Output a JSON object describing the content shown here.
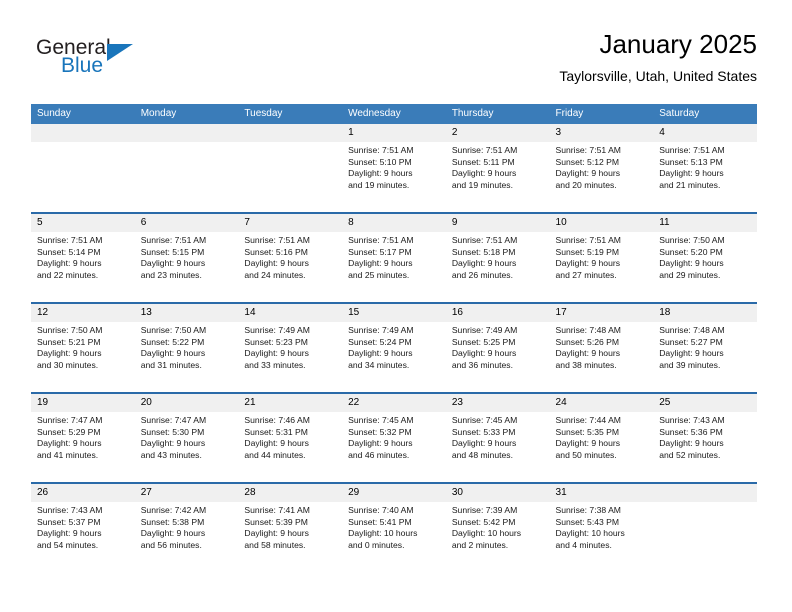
{
  "logo": {
    "text_primary": "General",
    "text_secondary": "Blue",
    "accent_color": "#1975bb"
  },
  "header": {
    "title": "January 2025",
    "subtitle": "Taylorsville, Utah, United States"
  },
  "theme": {
    "header_blue": "#3a7cb9",
    "row_divider_blue": "#2a6aa8",
    "day_band_gray": "#f0f0f0"
  },
  "weekday_headers": [
    "Sunday",
    "Monday",
    "Tuesday",
    "Wednesday",
    "Thursday",
    "Friday",
    "Saturday"
  ],
  "weeks": [
    [
      {
        "day": "",
        "lines": []
      },
      {
        "day": "",
        "lines": []
      },
      {
        "day": "",
        "lines": []
      },
      {
        "day": "1",
        "lines": [
          "Sunrise: 7:51 AM",
          "Sunset: 5:10 PM",
          "Daylight: 9 hours",
          "and 19 minutes."
        ]
      },
      {
        "day": "2",
        "lines": [
          "Sunrise: 7:51 AM",
          "Sunset: 5:11 PM",
          "Daylight: 9 hours",
          "and 19 minutes."
        ]
      },
      {
        "day": "3",
        "lines": [
          "Sunrise: 7:51 AM",
          "Sunset: 5:12 PM",
          "Daylight: 9 hours",
          "and 20 minutes."
        ]
      },
      {
        "day": "4",
        "lines": [
          "Sunrise: 7:51 AM",
          "Sunset: 5:13 PM",
          "Daylight: 9 hours",
          "and 21 minutes."
        ]
      }
    ],
    [
      {
        "day": "5",
        "lines": [
          "Sunrise: 7:51 AM",
          "Sunset: 5:14 PM",
          "Daylight: 9 hours",
          "and 22 minutes."
        ]
      },
      {
        "day": "6",
        "lines": [
          "Sunrise: 7:51 AM",
          "Sunset: 5:15 PM",
          "Daylight: 9 hours",
          "and 23 minutes."
        ]
      },
      {
        "day": "7",
        "lines": [
          "Sunrise: 7:51 AM",
          "Sunset: 5:16 PM",
          "Daylight: 9 hours",
          "and 24 minutes."
        ]
      },
      {
        "day": "8",
        "lines": [
          "Sunrise: 7:51 AM",
          "Sunset: 5:17 PM",
          "Daylight: 9 hours",
          "and 25 minutes."
        ]
      },
      {
        "day": "9",
        "lines": [
          "Sunrise: 7:51 AM",
          "Sunset: 5:18 PM",
          "Daylight: 9 hours",
          "and 26 minutes."
        ]
      },
      {
        "day": "10",
        "lines": [
          "Sunrise: 7:51 AM",
          "Sunset: 5:19 PM",
          "Daylight: 9 hours",
          "and 27 minutes."
        ]
      },
      {
        "day": "11",
        "lines": [
          "Sunrise: 7:50 AM",
          "Sunset: 5:20 PM",
          "Daylight: 9 hours",
          "and 29 minutes."
        ]
      }
    ],
    [
      {
        "day": "12",
        "lines": [
          "Sunrise: 7:50 AM",
          "Sunset: 5:21 PM",
          "Daylight: 9 hours",
          "and 30 minutes."
        ]
      },
      {
        "day": "13",
        "lines": [
          "Sunrise: 7:50 AM",
          "Sunset: 5:22 PM",
          "Daylight: 9 hours",
          "and 31 minutes."
        ]
      },
      {
        "day": "14",
        "lines": [
          "Sunrise: 7:49 AM",
          "Sunset: 5:23 PM",
          "Daylight: 9 hours",
          "and 33 minutes."
        ]
      },
      {
        "day": "15",
        "lines": [
          "Sunrise: 7:49 AM",
          "Sunset: 5:24 PM",
          "Daylight: 9 hours",
          "and 34 minutes."
        ]
      },
      {
        "day": "16",
        "lines": [
          "Sunrise: 7:49 AM",
          "Sunset: 5:25 PM",
          "Daylight: 9 hours",
          "and 36 minutes."
        ]
      },
      {
        "day": "17",
        "lines": [
          "Sunrise: 7:48 AM",
          "Sunset: 5:26 PM",
          "Daylight: 9 hours",
          "and 38 minutes."
        ]
      },
      {
        "day": "18",
        "lines": [
          "Sunrise: 7:48 AM",
          "Sunset: 5:27 PM",
          "Daylight: 9 hours",
          "and 39 minutes."
        ]
      }
    ],
    [
      {
        "day": "19",
        "lines": [
          "Sunrise: 7:47 AM",
          "Sunset: 5:29 PM",
          "Daylight: 9 hours",
          "and 41 minutes."
        ]
      },
      {
        "day": "20",
        "lines": [
          "Sunrise: 7:47 AM",
          "Sunset: 5:30 PM",
          "Daylight: 9 hours",
          "and 43 minutes."
        ]
      },
      {
        "day": "21",
        "lines": [
          "Sunrise: 7:46 AM",
          "Sunset: 5:31 PM",
          "Daylight: 9 hours",
          "and 44 minutes."
        ]
      },
      {
        "day": "22",
        "lines": [
          "Sunrise: 7:45 AM",
          "Sunset: 5:32 PM",
          "Daylight: 9 hours",
          "and 46 minutes."
        ]
      },
      {
        "day": "23",
        "lines": [
          "Sunrise: 7:45 AM",
          "Sunset: 5:33 PM",
          "Daylight: 9 hours",
          "and 48 minutes."
        ]
      },
      {
        "day": "24",
        "lines": [
          "Sunrise: 7:44 AM",
          "Sunset: 5:35 PM",
          "Daylight: 9 hours",
          "and 50 minutes."
        ]
      },
      {
        "day": "25",
        "lines": [
          "Sunrise: 7:43 AM",
          "Sunset: 5:36 PM",
          "Daylight: 9 hours",
          "and 52 minutes."
        ]
      }
    ],
    [
      {
        "day": "26",
        "lines": [
          "Sunrise: 7:43 AM",
          "Sunset: 5:37 PM",
          "Daylight: 9 hours",
          "and 54 minutes."
        ]
      },
      {
        "day": "27",
        "lines": [
          "Sunrise: 7:42 AM",
          "Sunset: 5:38 PM",
          "Daylight: 9 hours",
          "and 56 minutes."
        ]
      },
      {
        "day": "28",
        "lines": [
          "Sunrise: 7:41 AM",
          "Sunset: 5:39 PM",
          "Daylight: 9 hours",
          "and 58 minutes."
        ]
      },
      {
        "day": "29",
        "lines": [
          "Sunrise: 7:40 AM",
          "Sunset: 5:41 PM",
          "Daylight: 10 hours",
          "and 0 minutes."
        ]
      },
      {
        "day": "30",
        "lines": [
          "Sunrise: 7:39 AM",
          "Sunset: 5:42 PM",
          "Daylight: 10 hours",
          "and 2 minutes."
        ]
      },
      {
        "day": "31",
        "lines": [
          "Sunrise: 7:38 AM",
          "Sunset: 5:43 PM",
          "Daylight: 10 hours",
          "and 4 minutes."
        ]
      },
      {
        "day": "",
        "lines": []
      }
    ]
  ]
}
